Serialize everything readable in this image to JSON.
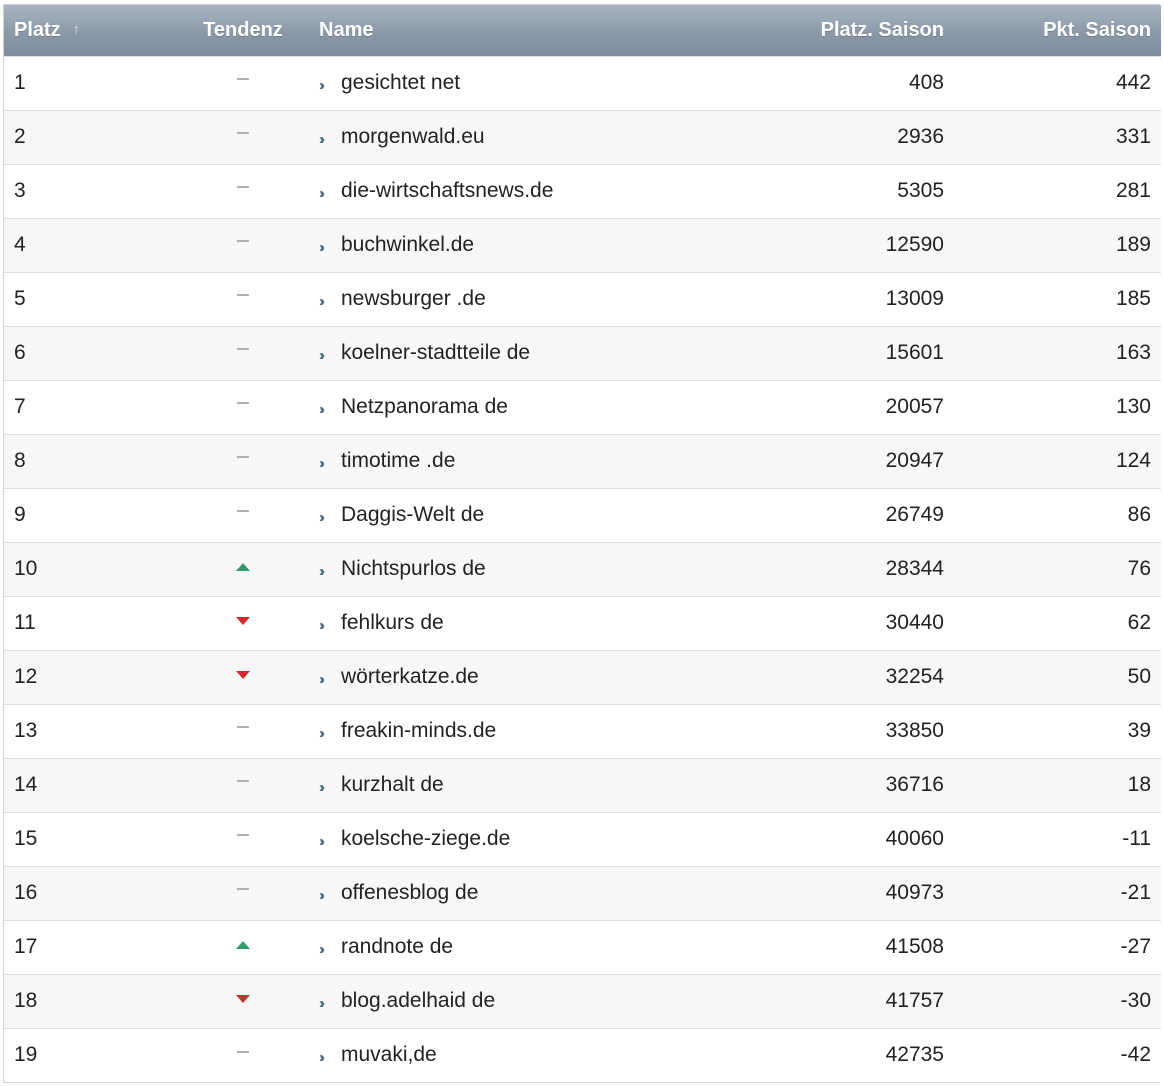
{
  "table": {
    "headers": {
      "platz": "Platz",
      "tendenz": "Tendenz",
      "name": "Name",
      "platz_saison": "Platz. Saison",
      "pkt_saison": "Pkt. Saison"
    },
    "sort_icon": "sort-ascending-icon",
    "rows": [
      {
        "platz": "1",
        "tendenz": "same",
        "name": "gesichtet net",
        "platz_saison": "408",
        "pkt_saison": "442"
      },
      {
        "platz": "2",
        "tendenz": "same",
        "name": "morgenwald.eu",
        "platz_saison": "2936",
        "pkt_saison": "331"
      },
      {
        "platz": "3",
        "tendenz": "same",
        "name": "die-wirtschaftsnews.de",
        "platz_saison": "5305",
        "pkt_saison": "281"
      },
      {
        "platz": "4",
        "tendenz": "same",
        "name": "buchwinkel.de",
        "platz_saison": "12590",
        "pkt_saison": "189"
      },
      {
        "platz": "5",
        "tendenz": "same",
        "name": "newsburger .de",
        "platz_saison": "13009",
        "pkt_saison": "185"
      },
      {
        "platz": "6",
        "tendenz": "same",
        "name": "koelner-stadtteile de",
        "platz_saison": "15601",
        "pkt_saison": "163"
      },
      {
        "platz": "7",
        "tendenz": "same",
        "name": "Netzpanorama de",
        "platz_saison": "20057",
        "pkt_saison": "130"
      },
      {
        "platz": "8",
        "tendenz": "same",
        "name": "timotime .de",
        "platz_saison": "20947",
        "pkt_saison": "124"
      },
      {
        "platz": "9",
        "tendenz": "same",
        "name": "Daggis-Welt de",
        "platz_saison": "26749",
        "pkt_saison": "86"
      },
      {
        "platz": "10",
        "tendenz": "up",
        "name": "Nichtspurlos de",
        "platz_saison": "28344",
        "pkt_saison": "76"
      },
      {
        "platz": "11",
        "tendenz": "down",
        "name": "fehlkurs de",
        "platz_saison": "30440",
        "pkt_saison": "62"
      },
      {
        "platz": "12",
        "tendenz": "down",
        "name": "wörterkatze.de",
        "platz_saison": "32254",
        "pkt_saison": "50"
      },
      {
        "platz": "13",
        "tendenz": "same",
        "name": "freakin-minds.de",
        "platz_saison": "33850",
        "pkt_saison": "39"
      },
      {
        "platz": "14",
        "tendenz": "same",
        "name": "kurzhalt de",
        "platz_saison": "36716",
        "pkt_saison": "18"
      },
      {
        "platz": "15",
        "tendenz": "same",
        "name": "koelsche-ziege.de",
        "platz_saison": "40060",
        "pkt_saison": "-11"
      },
      {
        "platz": "16",
        "tendenz": "same",
        "name": "offenesblog de",
        "platz_saison": "40973",
        "pkt_saison": "-21"
      },
      {
        "platz": "17",
        "tendenz": "up",
        "name": "randnote de",
        "platz_saison": "41508",
        "pkt_saison": "-27"
      },
      {
        "platz": "18",
        "tendenz": "down",
        "name": "blog.adelhaid de",
        "platz_saison": "41757",
        "pkt_saison": "-30"
      },
      {
        "platz": "19",
        "tendenz": "same",
        "name": "muvaki,de",
        "platz_saison": "42735",
        "pkt_saison": "-42"
      }
    ]
  },
  "colors": {
    "header_bg": "#8a98a8",
    "trend_up": "#2f9a6a",
    "trend_down": "#d02a2a",
    "trend_same": "#b0b0b0",
    "link_chevron": "#4d6685"
  }
}
